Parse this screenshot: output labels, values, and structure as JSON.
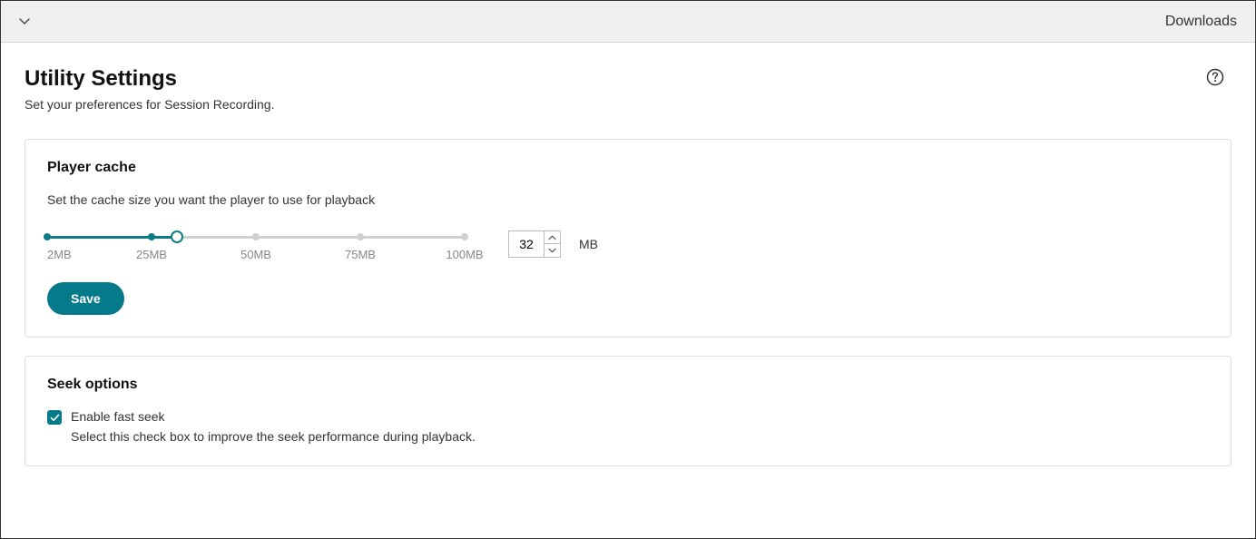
{
  "topbar": {
    "downloads_label": "Downloads"
  },
  "header": {
    "title": "Utility Settings",
    "subtitle": "Set your preferences for Session Recording."
  },
  "player_cache": {
    "title": "Player cache",
    "description": "Set the cache size you want the player to use for playback",
    "slider": {
      "ticks": [
        "2MB",
        "25MB",
        "50MB",
        "75MB",
        "100MB"
      ],
      "value_percent": 31
    },
    "input_value": "32",
    "unit": "MB",
    "save_label": "Save"
  },
  "seek_options": {
    "title": "Seek options",
    "checkbox_checked": true,
    "label": "Enable fast seek",
    "description": "Select this check box to improve the seek performance during playback."
  }
}
